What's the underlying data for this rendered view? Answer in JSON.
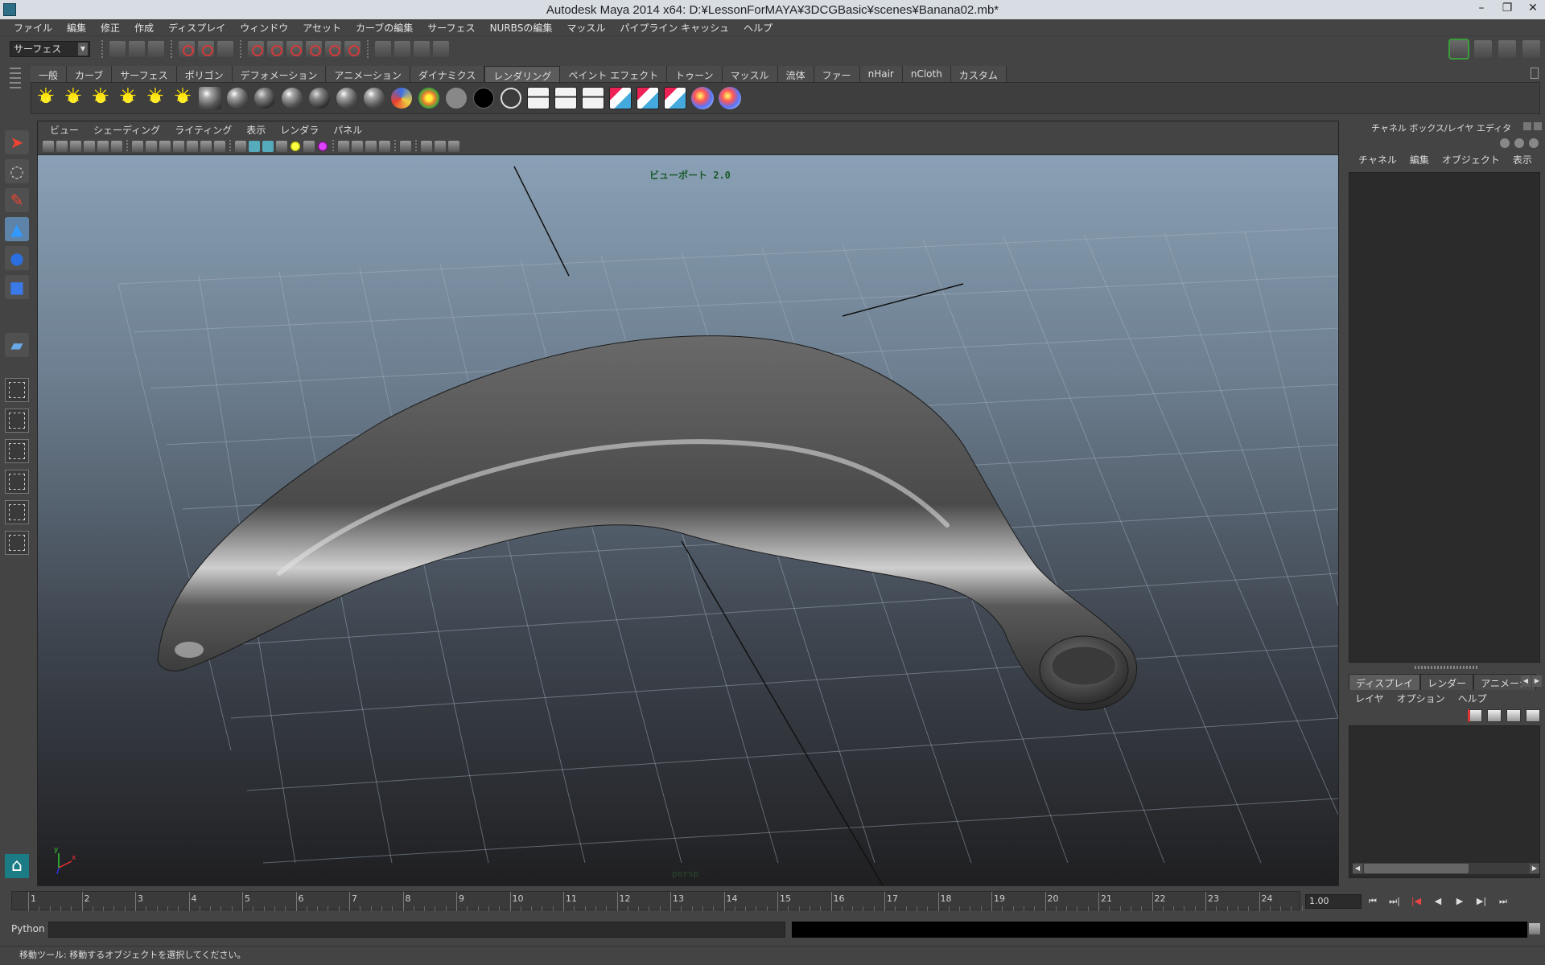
{
  "title": "Autodesk Maya 2014 x64: D:¥LessonForMAYA¥3DCGBasic¥scenes¥Banana02.mb*",
  "window_buttons": [
    "–",
    "❐",
    "✕"
  ],
  "menubar": [
    "ファイル",
    "編集",
    "修正",
    "作成",
    "ディスプレイ",
    "ウィンドウ",
    "アセット",
    "カーブの編集",
    "サーフェス",
    "NURBSの編集",
    "マッスル",
    "パイプライン キャッシュ",
    "ヘルプ"
  ],
  "statusline": {
    "mode": "サーフェス",
    "mode_arrow": "▼"
  },
  "shelf": {
    "tabs": [
      "一般",
      "カーブ",
      "サーフェス",
      "ポリゴン",
      "デフォメーション",
      "アニメーション",
      "ダイナミクス",
      "レンダリング",
      "ペイント エフェクト",
      "トゥーン",
      "マッスル",
      "流体",
      "ファー",
      "nHair",
      "nCloth",
      "カスタム"
    ],
    "active_tab": "レンダリング"
  },
  "viewport": {
    "menu": [
      "ビュー",
      "シェーディング",
      "ライティング",
      "表示",
      "レンダラ",
      "パネル"
    ],
    "renderer_label": "ビューポート 2.0",
    "camera": "persp",
    "axis_x": "x",
    "axis_y": "y",
    "colors": {
      "sky_top": "#8aa0b5",
      "floor_bottom": "#1f1f21",
      "grid": "#a8b6c6",
      "banana_mid": "#5a5a5a"
    }
  },
  "right_panel": {
    "header": "チャネル ボックス/レイヤ エディタ",
    "menu": [
      "チャネル",
      "編集",
      "オブジェクト",
      "表示"
    ],
    "layer_tabs": [
      "ディスプレイ",
      "レンダー",
      "アニメーシ"
    ],
    "active_layer_tab": "ディスプレイ",
    "layer_menu": [
      "レイヤ",
      "オプション",
      "ヘルプ"
    ]
  },
  "timeslider": {
    "frames": [
      "1",
      "2",
      "3",
      "4",
      "5",
      "6",
      "7",
      "8",
      "9",
      "10",
      "11",
      "12",
      "13",
      "14",
      "15",
      "16",
      "17",
      "18",
      "19",
      "20",
      "21",
      "22",
      "23",
      "24"
    ],
    "current": "1.00",
    "playback": [
      "⏮",
      "⏭|",
      "|◀",
      "◀",
      "▶",
      "▶|",
      "⏭"
    ]
  },
  "cmdline": {
    "language": "Python"
  },
  "helpline": {
    "text": "移動ツール: 移動するオブジェクトを選択してください。"
  }
}
